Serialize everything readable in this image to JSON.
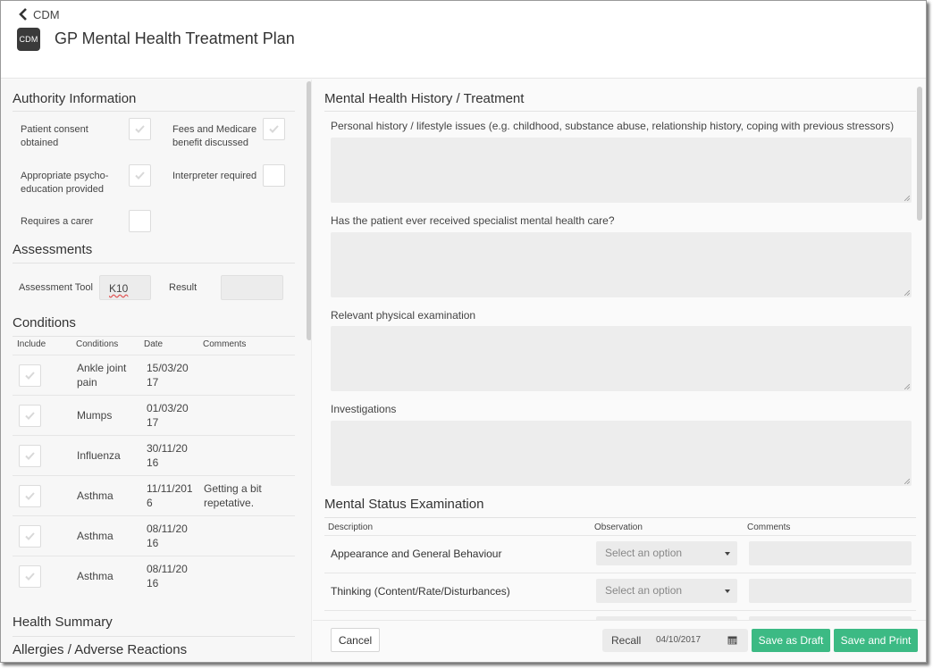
{
  "header": {
    "back_label": "CDM",
    "app_badge": "CDM",
    "title": "GP Mental Health Treatment Plan"
  },
  "authority": {
    "title": "Authority Information",
    "fields": [
      {
        "label": "Patient consent obtained",
        "checked": true
      },
      {
        "label": "Fees and Medicare benefit discussed",
        "checked": true
      },
      {
        "label": "Appropriate psycho-education provided",
        "checked": true
      },
      {
        "label": "Interpreter required",
        "checked": false
      },
      {
        "label": "Requires a carer",
        "checked": false
      }
    ]
  },
  "assessments": {
    "title": "Assessments",
    "tool_label": "Assessment Tool",
    "tool_value": "K10",
    "result_label": "Result",
    "result_value": ""
  },
  "conditions": {
    "title": "Conditions",
    "columns": [
      "Include",
      "Conditions",
      "Date",
      "Comments"
    ],
    "rows": [
      {
        "include": true,
        "condition": "Ankle joint pain",
        "date": "15/03/2017",
        "comments": ""
      },
      {
        "include": true,
        "condition": "Mumps",
        "date": "01/03/2017",
        "comments": ""
      },
      {
        "include": true,
        "condition": "Influenza",
        "date": "30/11/2016",
        "comments": ""
      },
      {
        "include": true,
        "condition": "Asthma",
        "date": "11/11/2016",
        "comments": "Getting a bit repetative."
      },
      {
        "include": true,
        "condition": "Asthma",
        "date": "08/11/2016",
        "comments": ""
      },
      {
        "include": true,
        "condition": "Asthma",
        "date": "08/11/2016",
        "comments": ""
      }
    ]
  },
  "health_summary": {
    "title": "Health Summary"
  },
  "allergies": {
    "title": "Allergies / Adverse Reactions"
  },
  "mh_history": {
    "title": "Mental Health History / Treatment",
    "fields": [
      {
        "label": "Personal history / lifestyle issues (e.g. childhood, substance abuse, relationship history, coping with previous stressors)",
        "value": ""
      },
      {
        "label": "Has the patient ever received specialist mental health care?",
        "value": ""
      },
      {
        "label": "Relevant physical examination",
        "value": ""
      },
      {
        "label": "Investigations",
        "value": ""
      }
    ]
  },
  "mse": {
    "title": "Mental Status Examination",
    "columns": [
      "Description",
      "Observation",
      "Comments"
    ],
    "rows": [
      {
        "description": "Appearance and General Behaviour",
        "observation": "Select an option",
        "comments": ""
      },
      {
        "description": "Thinking (Content/Rate/Disturbances)",
        "observation": "Select an option",
        "comments": ""
      },
      {
        "description": "",
        "observation": "",
        "comments": ""
      }
    ]
  },
  "footer": {
    "cancel_label": "Cancel",
    "recall_label": "Recall",
    "recall_date": "04/10/2017",
    "save_draft_label": "Save as Draft",
    "save_print_label": "Save and Print"
  },
  "colors": {
    "primary_green": "#3cba84",
    "badge_dark": "#3a3a3a"
  }
}
